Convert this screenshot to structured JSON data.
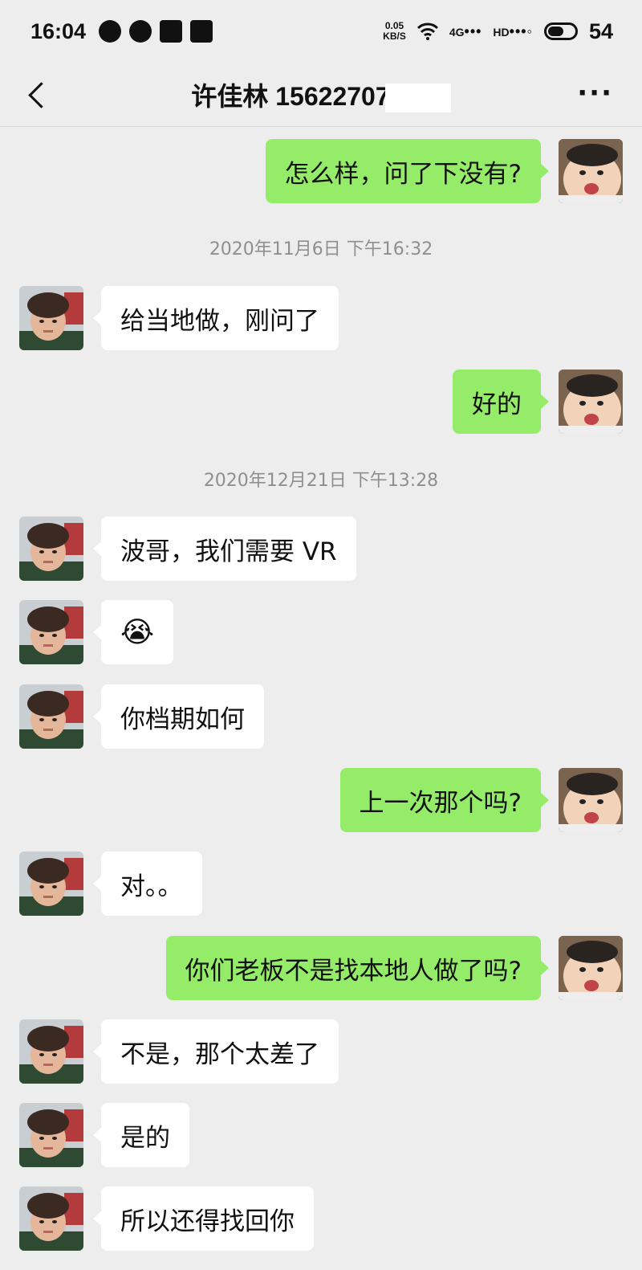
{
  "status_bar": {
    "time": "16:04",
    "net_speed_value": "0.05",
    "net_speed_unit": "KB/S",
    "net_type": "4G",
    "hd": "HD",
    "battery": "54",
    "battery_level": 0.54,
    "left_icons": [
      "wechat-icon",
      "drop-icon",
      "image-icon",
      "alarm-icon"
    ]
  },
  "header": {
    "title": "许佳林 1562270",
    "title_suffix": "7"
  },
  "messages": [
    {
      "type": "out",
      "text": "怎么样，问了下没有?"
    },
    {
      "type": "time",
      "text": "2020年11月6日 下午16:32"
    },
    {
      "type": "in",
      "text": "给当地做，刚问了"
    },
    {
      "type": "out",
      "text": "好的"
    },
    {
      "type": "time",
      "text": "2020年12月21日 下午13:28"
    },
    {
      "type": "in",
      "text": "波哥，我们需要 VR"
    },
    {
      "type": "in",
      "text": "😭"
    },
    {
      "type": "in",
      "text": "你档期如何"
    },
    {
      "type": "out",
      "text": "上一次那个吗?"
    },
    {
      "type": "in",
      "text": "对。。"
    },
    {
      "type": "out",
      "text": "你们老板不是找本地人做了吗?"
    },
    {
      "type": "in",
      "text": "不是，那个太差了"
    },
    {
      "type": "in",
      "text": "是的"
    },
    {
      "type": "in",
      "text": "所以还得找回你"
    }
  ]
}
